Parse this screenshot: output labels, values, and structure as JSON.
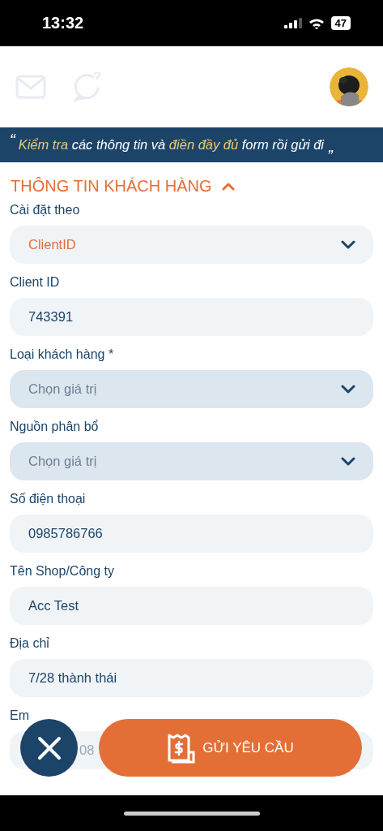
{
  "status_bar": {
    "time": "13:32",
    "battery": "47"
  },
  "banner": {
    "open_quote": "“",
    "close_quote": "”",
    "segments": [
      {
        "text": "Kiểm tra",
        "highlight": true
      },
      {
        "text": " các thông tin và ",
        "highlight": false
      },
      {
        "text": "điền đầy đủ",
        "highlight": true
      },
      {
        "text": " form rồi gửi đi",
        "highlight": false
      }
    ]
  },
  "section": {
    "title": "THÔNG TIN KHÁCH HÀNG",
    "expanded": true
  },
  "fields": [
    {
      "label": "Cài đặt theo",
      "kind": "select",
      "value": "ClientID"
    },
    {
      "label": "Client ID",
      "kind": "text",
      "value": "743391"
    },
    {
      "label": "Loại khách hàng *",
      "kind": "select",
      "placeholder": "Chọn giá trị"
    },
    {
      "label": "Nguồn phân bổ",
      "kind": "select",
      "placeholder": "Chọn giá trị"
    },
    {
      "label": "Số điện thoại",
      "kind": "text",
      "value": "0985786766"
    },
    {
      "label": "Tên Shop/Công ty",
      "kind": "text",
      "value": "Acc Test"
    },
    {
      "label": "Địa chỉ",
      "kind": "text",
      "value": "7/28 thành thái"
    },
    {
      "label": "Em",
      "kind": "partial",
      "value": "08"
    }
  ],
  "submit_button": {
    "label": "GỬI YÊU CẦU"
  }
}
